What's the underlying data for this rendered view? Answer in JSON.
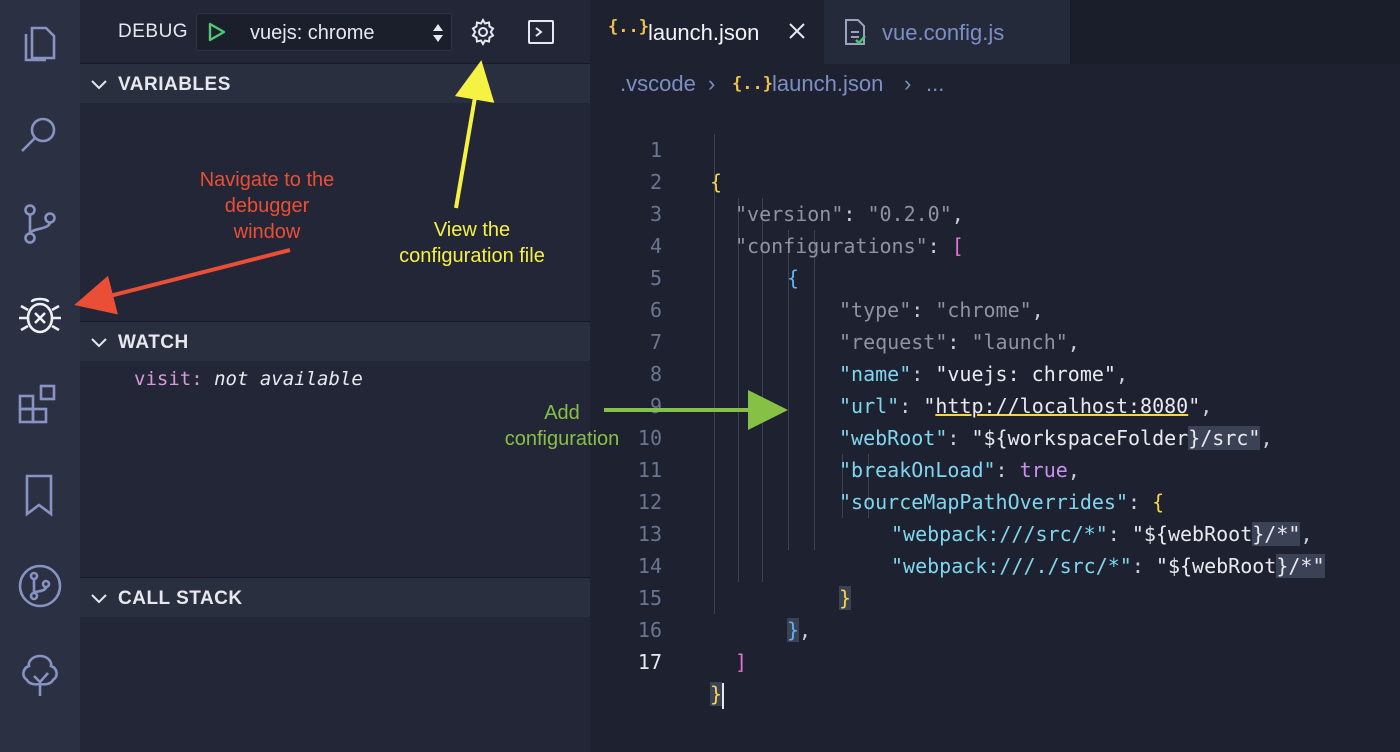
{
  "activity_bar": {
    "icons": [
      "files-icon",
      "search-icon",
      "source-control-icon",
      "debug-icon",
      "extensions-icon",
      "bookmark-icon",
      "git-graph-icon",
      "tree-icon"
    ]
  },
  "debug": {
    "label": "DEBUG",
    "configuration": "vuejs: chrome"
  },
  "sections": {
    "variables": "VARIABLES",
    "watch": "WATCH",
    "call_stack": "CALL STACK"
  },
  "watch": {
    "expression": "visit:",
    "value": "not available"
  },
  "tabs": [
    {
      "icon": "{..}",
      "label": "launch.json",
      "active": true
    },
    {
      "icon": "file-check-icon",
      "label": "vue.config.js",
      "active": false
    }
  ],
  "breadcrumb": {
    "folder": ".vscode",
    "file_icon": "{..}",
    "file": "launch.json",
    "more": "..."
  },
  "editor": {
    "current_line": 17,
    "line_numbers": [
      "1",
      "2",
      "3",
      "4",
      "5",
      "6",
      "7",
      "8",
      "9",
      "10",
      "11",
      "12",
      "13",
      "14",
      "15",
      "16",
      "17"
    ],
    "strings": {
      "version_key": "\"version\"",
      "version_val": "\"0.2.0\"",
      "configurations_key": "\"configurations\"",
      "type_key": "\"type\"",
      "type_val": "\"chrome\"",
      "request_key": "\"request\"",
      "request_val": "\"launch\"",
      "name_key": "\"name\"",
      "name_val": "\"vuejs: chrome\"",
      "url_key": "\"url\"",
      "url_val": "http://localhost:8080",
      "webroot_key": "\"webRoot\"",
      "webroot_val_a": "\"${workspaceFolder",
      "webroot_val_b": "}/src\"",
      "breakonload_key": "\"breakOnLoad\"",
      "breakonload_val": "true",
      "smpo_key": "\"sourceMapPathOverrides\"",
      "wp1_key": "\"webpack:///src/*\"",
      "wp1_val_a": "\"${webRoot",
      "wp1_val_b": "}/*\"",
      "wp2_key": "\"webpack:///./src/*\"",
      "wp2_val_a": "\"${webRoot",
      "wp2_val_b": "}/*\""
    }
  },
  "annotations": {
    "navigate": [
      "Navigate to the",
      "debugger",
      "window"
    ],
    "view_config": [
      "View the",
      "configuration file"
    ],
    "add_config": [
      "Add",
      "configuration"
    ]
  },
  "colors": {
    "annotation_red": "#ea4f35",
    "annotation_yellow": "#f5f243",
    "annotation_green": "#86c045",
    "bracket_yellow": "#f5d547",
    "bracket_pink": "#e474d1",
    "bracket_blue": "#5fb2f5"
  }
}
